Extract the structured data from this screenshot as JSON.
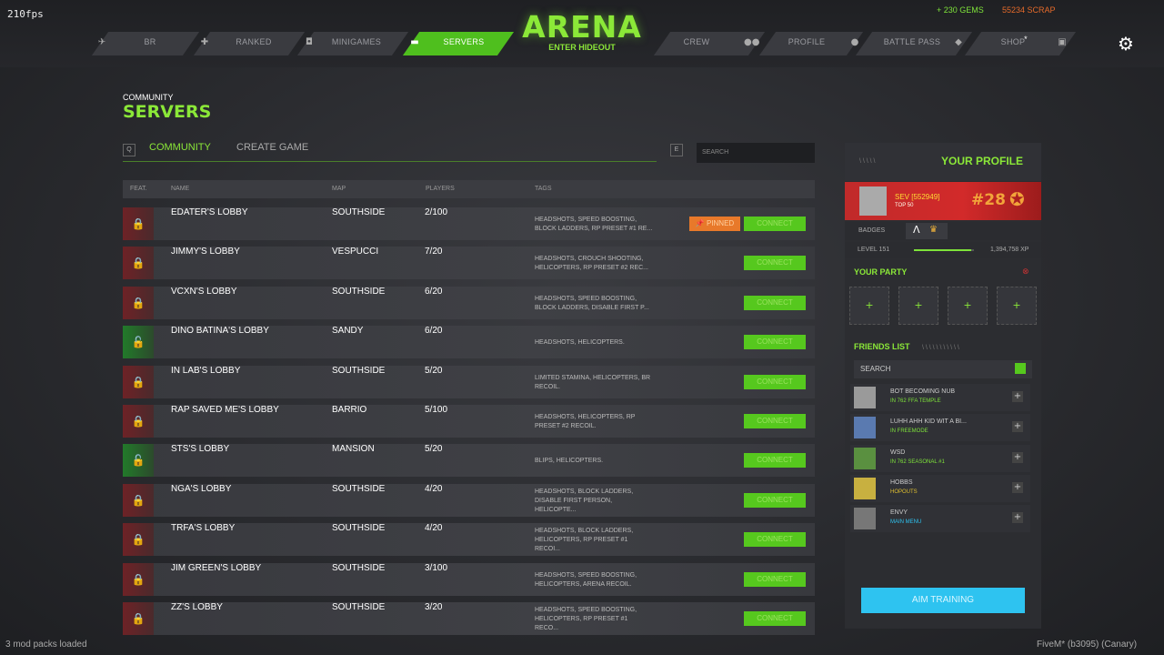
{
  "fps": "210fps",
  "nav": {
    "items": [
      {
        "label": "BR",
        "icon": "plane-icon"
      },
      {
        "label": "RANKED",
        "icon": "crosshair-icon"
      },
      {
        "label": "MINIGAMES",
        "icon": "gamepad-icon"
      },
      {
        "label": "SERVERS",
        "icon": "server-icon"
      },
      {
        "label": "CREW",
        "icon": "crew-icon"
      },
      {
        "label": "PROFILE",
        "icon": "person-icon"
      },
      {
        "label": "BATTLE PASS",
        "icon": "ticket-icon"
      },
      {
        "label": "SHOP",
        "icon": "store-icon"
      }
    ],
    "shop_badge": "*",
    "logo_title": "ARENA",
    "logo_sub": "ENTER HIDEOUT"
  },
  "currency": {
    "gems": "+ 230 GEMS",
    "scrap": "55234 SCRAP"
  },
  "section": {
    "sub": "COMMUNITY",
    "title": "SERVERS"
  },
  "tabs": {
    "key_left": "Q",
    "key_right": "E",
    "community": "COMMUNITY",
    "create": "CREATE GAME",
    "search_placeholder": "SEARCH"
  },
  "table": {
    "headers": {
      "feat": "FEAT.",
      "name": "NAME",
      "map": "MAP",
      "players": "PLAYERS",
      "tags": "TAGS"
    },
    "connect_label": "CONNECT",
    "pinned_label": "PINNED",
    "rows": [
      {
        "locked": true,
        "name": "EDATER'S LOBBY",
        "map": "SOUTHSIDE",
        "players": "2/100",
        "tags": "HEADSHOTS, SPEED BOOSTING, BLOCK LADDERS, RP PRESET #1 RE...",
        "pinned": true
      },
      {
        "locked": true,
        "name": "JIMMY'S LOBBY",
        "map": "VESPUCCI",
        "players": "7/20",
        "tags": "HEADSHOTS, CROUCH SHOOTING, HELICOPTERS, RP PRESET #2 REC..."
      },
      {
        "locked": true,
        "name": "VCXN'S LOBBY",
        "map": "SOUTHSIDE",
        "players": "6/20",
        "tags": "HEADSHOTS, SPEED BOOSTING, BLOCK LADDERS, DISABLE FIRST P..."
      },
      {
        "locked": false,
        "name": "DINO BATINA'S LOBBY",
        "map": "SANDY",
        "players": "6/20",
        "tags": "HEADSHOTS, HELICOPTERS."
      },
      {
        "locked": true,
        "name": "IN LAB'S LOBBY",
        "map": "SOUTHSIDE",
        "players": "5/20",
        "tags": "LIMITED STAMINA, HELICOPTERS, BR RECOIL."
      },
      {
        "locked": true,
        "name": "RAP SAVED ME'S LOBBY",
        "map": "BARRIO",
        "players": "5/100",
        "tags": "HEADSHOTS, HELICOPTERS, RP PRESET #2 RECOIL."
      },
      {
        "locked": false,
        "name": "STS'S LOBBY",
        "map": "MANSION",
        "players": "5/20",
        "tags": "BLIPS, HELICOPTERS."
      },
      {
        "locked": true,
        "name": "NGA'S LOBBY",
        "map": "SOUTHSIDE",
        "players": "4/20",
        "tags": "HEADSHOTS, BLOCK LADDERS, DISABLE FIRST PERSON, HELICOPTE..."
      },
      {
        "locked": true,
        "name": "TRFA'S LOBBY",
        "map": "SOUTHSIDE",
        "players": "4/20",
        "tags": "HEADSHOTS, BLOCK LADDERS, HELICOPTERS, RP PRESET #1 RECOI..."
      },
      {
        "locked": true,
        "name": "JIM GREEN'S LOBBY",
        "map": "SOUTHSIDE",
        "players": "3/100",
        "tags": "HEADSHOTS, SPEED BOOSTING, HELICOPTERS, ARENA RECOIL."
      },
      {
        "locked": true,
        "name": "ZZ'S LOBBY",
        "map": "SOUTHSIDE",
        "players": "3/20",
        "tags": "HEADSHOTS, SPEED BOOSTING, HELICOPTERS, RP PRESET #1 RECO..."
      }
    ]
  },
  "profile": {
    "slashes": "\\ \\ \\ \\ \\",
    "title": "YOUR PROFILE",
    "name": "SEV [552949]",
    "top": "TOP 50",
    "rank": "#28",
    "badges_label": "BADGES",
    "level": "LEVEL 151",
    "xp": "1,394,758 XP",
    "xp_progress": 0.95
  },
  "party": {
    "title": "YOUR PARTY",
    "slots": [
      "+",
      "+",
      "+",
      "+"
    ]
  },
  "friends": {
    "title": "FRIENDS LIST",
    "slashes": "\\ \\ \\ \\ \\ \\ \\ \\ \\ \\ \\",
    "search": "SEARCH",
    "items": [
      {
        "name": "BOT BECOMING NUB",
        "status": "IN 762 FFA TEMPLE",
        "color": "#7ee23a"
      },
      {
        "name": "LUHH AHH KID WIT A BI...",
        "status": "IN FREEMODE",
        "color": "#7ee23a"
      },
      {
        "name": "WSD",
        "status": "IN 762 SEASONAL #1",
        "color": "#7ee23a"
      },
      {
        "name": "HOBBS",
        "status": "HOPOUTS",
        "color": "#e0c030"
      },
      {
        "name": "ENVY",
        "status": "MAIN MENU",
        "color": "#2ec3f0"
      }
    ]
  },
  "aim_training": "AIM TRAINING",
  "footer": {
    "left": "3 mod packs loaded",
    "right": "FiveM* (b3095) (Canary)"
  }
}
